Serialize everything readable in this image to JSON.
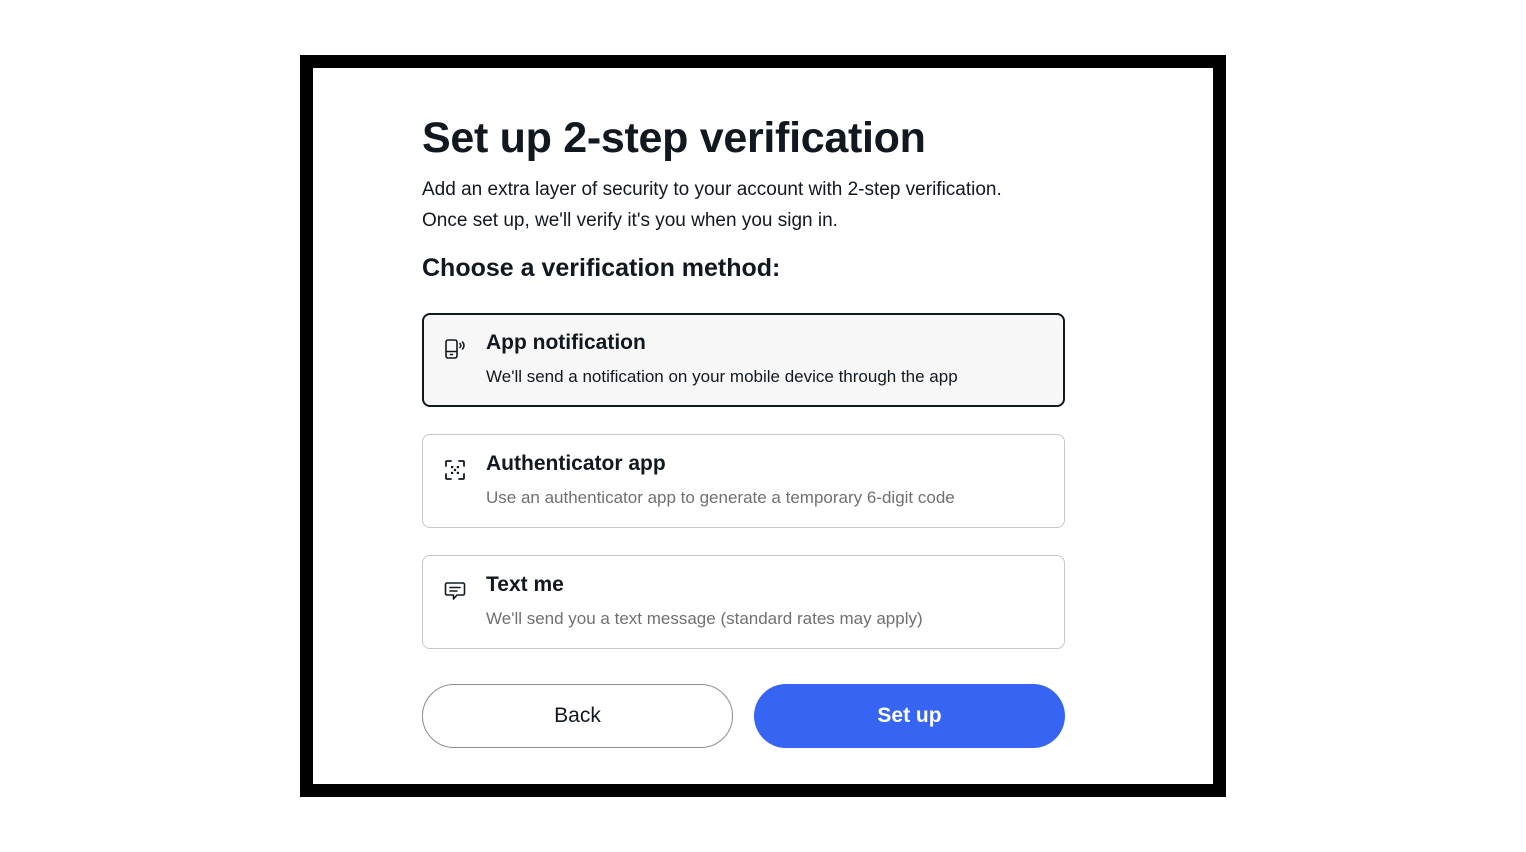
{
  "page": {
    "title": "Set up 2-step verification",
    "subtitle_line1": "Add an extra layer of security to your account with 2-step verification.",
    "subtitle_line2": "Once set up, we'll verify it's you when you sign in.",
    "section_heading": "Choose a verification method:"
  },
  "options": [
    {
      "title": "App notification",
      "description": "We'll send a notification on your mobile device through the app",
      "icon": "mobile-notification-icon",
      "selected": true
    },
    {
      "title": "Authenticator app",
      "description": "Use an authenticator app to generate a temporary 6-digit code",
      "icon": "qr-scan-icon",
      "selected": false
    },
    {
      "title": "Text me",
      "description": "We'll send you a text message (standard rates may apply)",
      "icon": "message-icon",
      "selected": false
    }
  ],
  "buttons": {
    "back_label": "Back",
    "setup_label": "Set up"
  },
  "colors": {
    "primary": "#3665f3",
    "text": "#111820",
    "muted_text": "#707070",
    "frame": "#000000"
  }
}
